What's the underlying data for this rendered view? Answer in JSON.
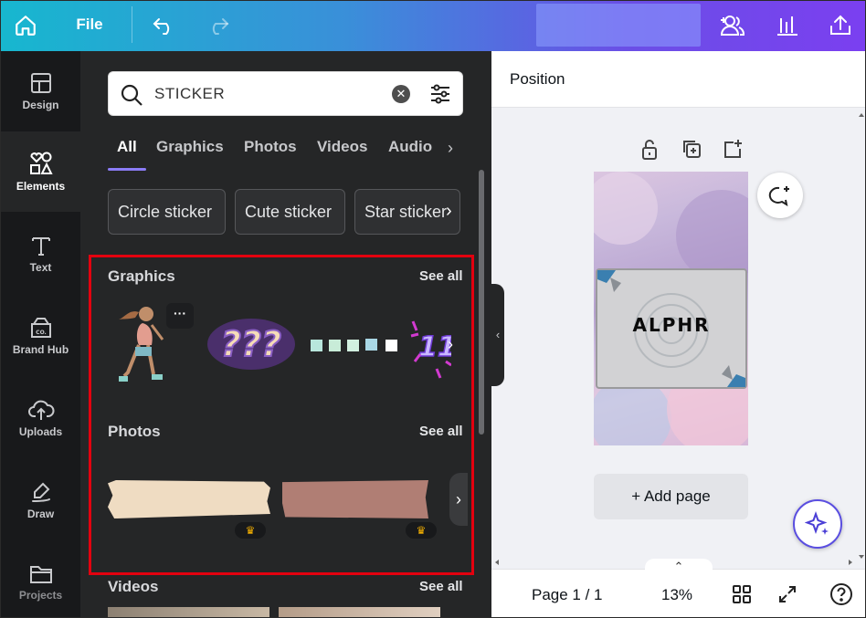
{
  "topbar": {
    "file_label": "File",
    "icons": [
      "home-icon",
      "undo-icon",
      "redo-icon",
      "share-people-icon",
      "insights-icon",
      "upload-icon"
    ]
  },
  "rail": {
    "items": [
      {
        "label": "Design",
        "icon": "design-icon"
      },
      {
        "label": "Elements",
        "icon": "elements-icon",
        "active": true
      },
      {
        "label": "Text",
        "icon": "text-icon"
      },
      {
        "label": "Brand Hub",
        "icon": "brand-hub-icon"
      },
      {
        "label": "Uploads",
        "icon": "upload-cloud-icon"
      },
      {
        "label": "Draw",
        "icon": "draw-icon"
      },
      {
        "label": "Projects",
        "icon": "folder-icon"
      }
    ]
  },
  "search": {
    "value": "STICKER",
    "icons": [
      "search-icon",
      "clear-icon",
      "filter-icon"
    ]
  },
  "tabs": [
    "All",
    "Graphics",
    "Photos",
    "Videos",
    "Audio"
  ],
  "chips": [
    "Circle sticker",
    "Cute sticker",
    "Star sticker"
  ],
  "sections": {
    "graphics": {
      "title": "Graphics",
      "see_all": "See all",
      "more": "···",
      "sticker_text": "???"
    },
    "photos": {
      "title": "Photos",
      "see_all": "See all"
    },
    "videos": {
      "title": "Videos",
      "see_all": "See all"
    }
  },
  "right": {
    "header_title": "Position",
    "page_card_text": "ALPHR",
    "add_page": "+ Add page",
    "footer": {
      "page": "Page 1 / 1",
      "zoom": "13%"
    }
  },
  "colors": {
    "highlight": "#e3000f",
    "accent": "#8b7cf6",
    "panel": "#252627",
    "rail": "#18191b"
  }
}
